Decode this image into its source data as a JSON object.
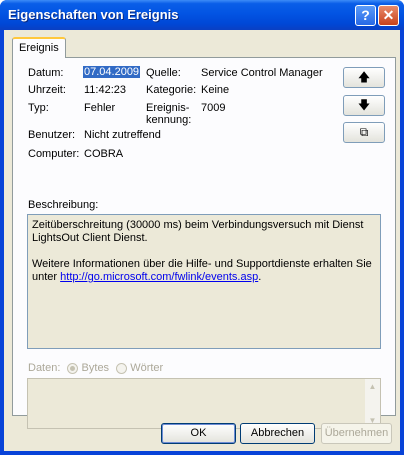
{
  "window": {
    "title": "Eigenschaften von Ereignis",
    "help_glyph": "?",
    "close_glyph": "✕"
  },
  "tab": {
    "label": "Ereignis"
  },
  "fields": {
    "datum_label": "Datum:",
    "datum_value": "07.04.2009",
    "uhrzeit_label": "Uhrzeit:",
    "uhrzeit_value": "11:42:23",
    "typ_label": "Typ:",
    "typ_value": "Fehler",
    "benutzer_label": "Benutzer:",
    "benutzer_value": "Nicht zutreffend",
    "computer_label": "Computer:",
    "computer_value": "COBRA",
    "quelle_label": "Quelle:",
    "quelle_value": "Service Control Manager",
    "kategorie_label": "Kategorie:",
    "kategorie_value": "Keine",
    "kennung_label_1": "Ereignis-",
    "kennung_label_2": "kennung:",
    "kennung_value": "7009"
  },
  "side_buttons": {
    "up_glyph": "🡅",
    "down_glyph": "🡇",
    "copy_glyph": "⧉"
  },
  "description": {
    "label": "Beschreibung:",
    "line1": "Zeitüberschreitung (30000 ms) beim Verbindungsversuch mit Dienst LightsOut Client Dienst.",
    "line2": "Weitere Informationen über die Hilfe- und Supportdienste erhalten Sie unter ",
    "link": "http://go.microsoft.com/fwlink/events.asp",
    "link_suffix": "."
  },
  "data": {
    "label": "Daten:",
    "option_bytes": "Bytes",
    "option_words": "Wörter",
    "selected": "Bytes"
  },
  "buttons": {
    "ok": "OK",
    "cancel": "Abbrechen",
    "apply": "Übernehmen"
  },
  "colors": {
    "title_bar": "#0254e3",
    "face": "#ece9d8",
    "selection": "#316ac5"
  }
}
